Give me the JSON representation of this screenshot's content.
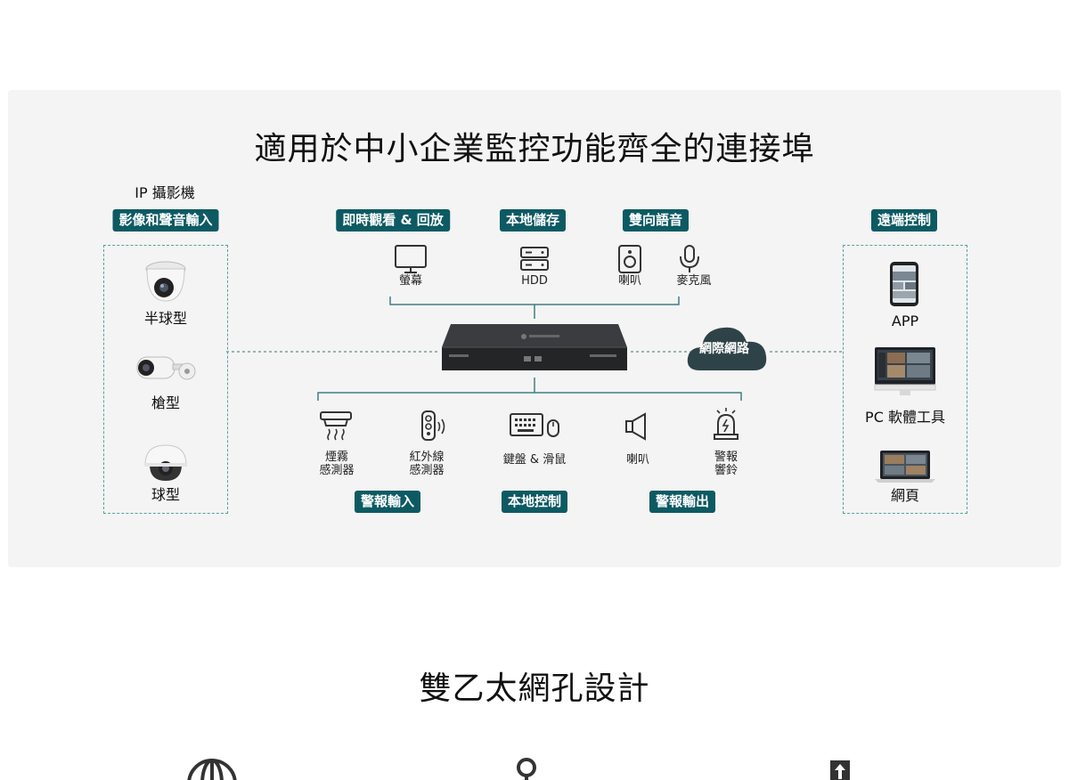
{
  "page": {
    "title": "適用於中小企業監控功能齊全的連接埠",
    "section2_title": "雙乙太網孔設計"
  },
  "left": {
    "header": "IP 攝影機",
    "badge": "影像和聲音輸入",
    "items": [
      "半球型",
      "槍型",
      "球型"
    ]
  },
  "top": {
    "badges": [
      "即時觀看 & 回放",
      "本地儲存",
      "雙向語音"
    ],
    "devices": [
      "螢幕",
      "HDD",
      "喇叭",
      "麥克風"
    ]
  },
  "bottom": {
    "devices": [
      {
        "line1": "煙霧",
        "line2": "感測器"
      },
      {
        "line1": "紅外線",
        "line2": "感測器"
      },
      {
        "line1": "鍵盤 & 滑鼠",
        "line2": ""
      },
      {
        "line1": "喇叭",
        "line2": ""
      },
      {
        "line1": "警報",
        "line2": "響鈴"
      }
    ],
    "badges": [
      "警報輸入",
      "本地控制",
      "警報輸出"
    ]
  },
  "cloud": {
    "label": "網際網路"
  },
  "right": {
    "badge": "遠端控制",
    "items": [
      "APP",
      "PC 軟體工具",
      "網頁"
    ]
  },
  "colors": {
    "accent": "#0d5a63",
    "line": "#3f7f83",
    "panel": "#f4f4f4",
    "nvr": "#2b2d2f"
  },
  "icons": [
    "dome-camera-icon",
    "bullet-camera-icon",
    "turret-camera-icon",
    "monitor-icon",
    "hdd-icon",
    "speaker-icon",
    "microphone-icon",
    "nvr-device-icon",
    "cloud-icon",
    "smartphone-icon",
    "desktop-pc-icon",
    "laptop-icon",
    "smoke-sensor-icon",
    "ir-sensor-icon",
    "keyboard-mouse-icon",
    "loudspeaker-icon",
    "alarm-bell-icon",
    "globe-icon",
    "location-pin-icon",
    "upload-icon"
  ]
}
